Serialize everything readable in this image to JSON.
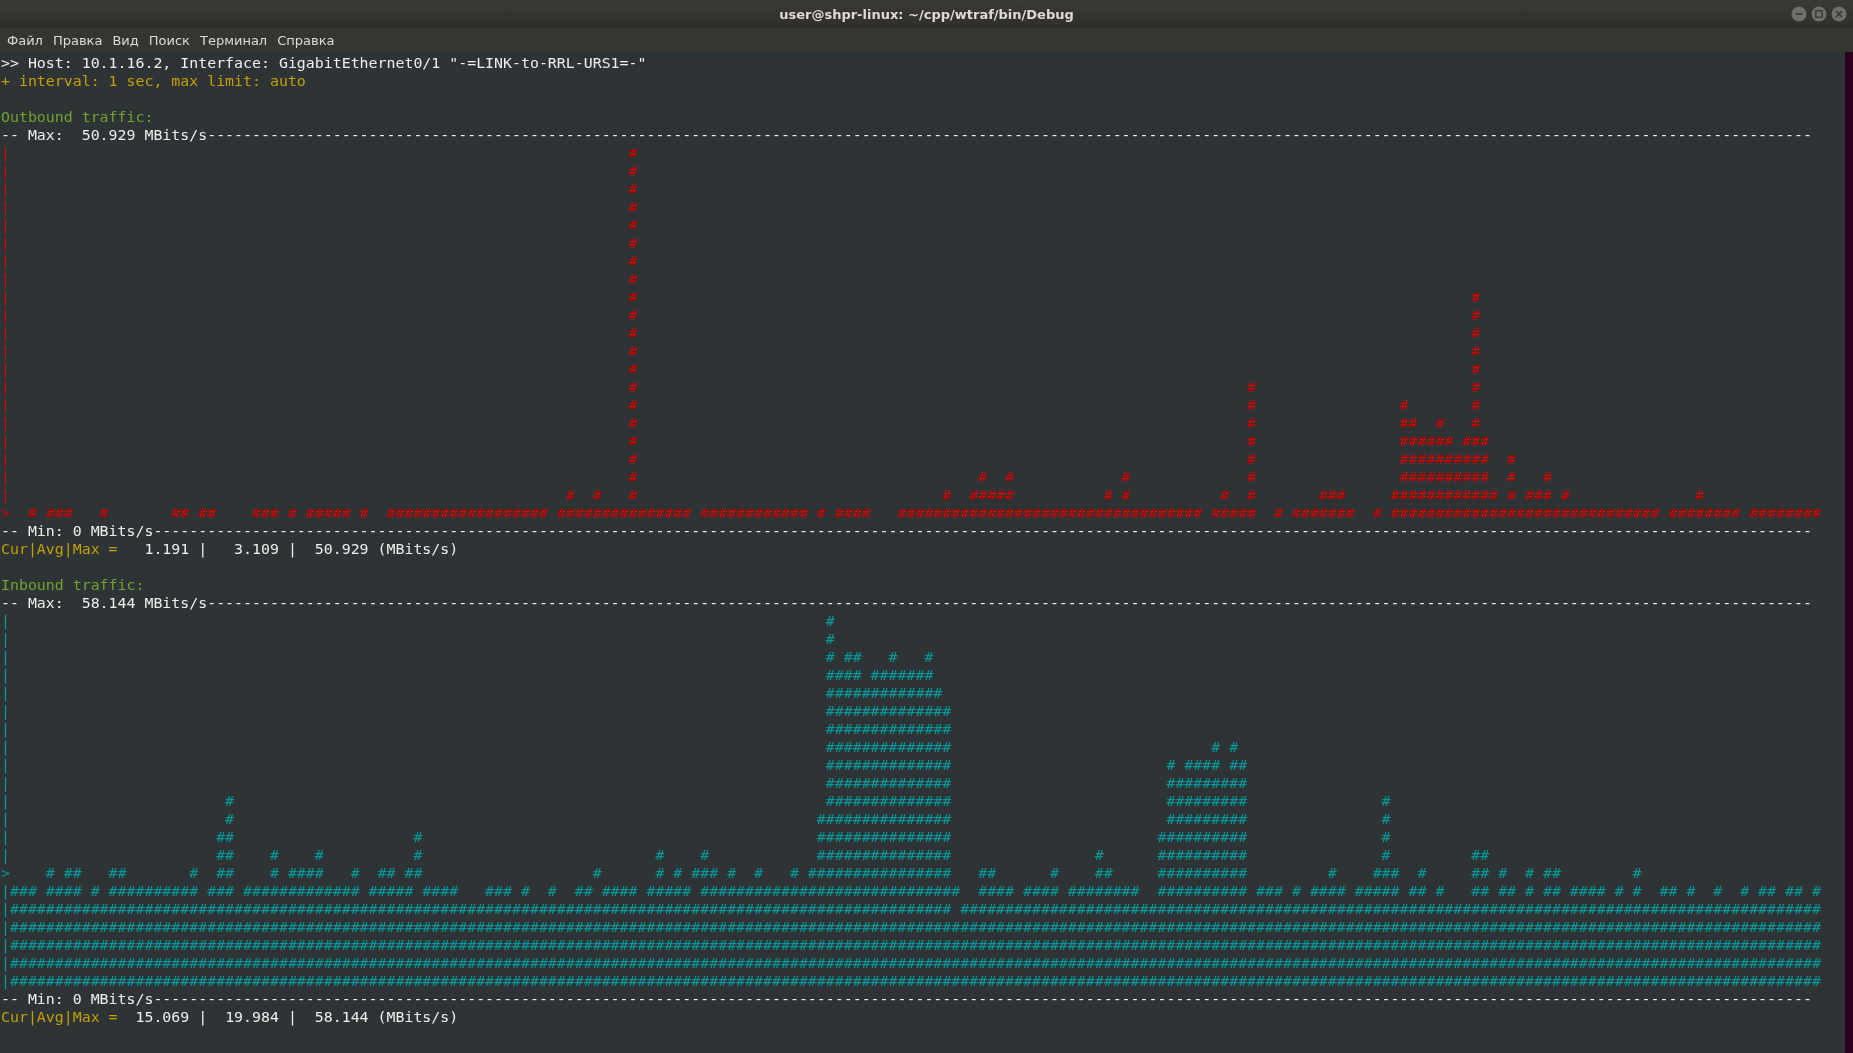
{
  "window": {
    "title": "user@shpr-linux: ~/cpp/wtraf/bin/Debug"
  },
  "menu": [
    {
      "label": "Файл"
    },
    {
      "label": "Правка"
    },
    {
      "label": "Вид"
    },
    {
      "label": "Поиск"
    },
    {
      "label": "Терминал"
    },
    {
      "label": "Справка"
    }
  ],
  "terminal": {
    "host_line": ">> Host: 10.1.16.2, Interface: GigabitEthernet0/1 \"-=LINK-to-RRL-URS1=-\"",
    "interval_line": "+ interval: 1 sec, max limit: auto",
    "sections": [
      {
        "kind": "outbound",
        "heading": "Outbound traffic:",
        "max_line": "-- Max:  50.929 MBits/s-----------------------------------------------------------------------------------------------------------------------------------------------------------------------------------",
        "rows": [
          "|                                                                     #",
          "|                                                                     #",
          "|                                                                     #",
          "|                                                                     #",
          "|                                                                     #",
          "|                                                                     #",
          "|                                                                     #",
          "|                                                                     #",
          "|                                                                     #                                                                                             #",
          "|                                                                     #                                                                                             #",
          "|                                                                     #                                                                                             #",
          "|                                                                     #                                                                                             #",
          "|                                                                     #                                                                                             #",
          "|                                                                     #                                                                    #                        #",
          "|                                                                     #                                                                    #                #       #",
          "|                                                                     #                                                                    #                ##  #   #",
          "|                                                                     #                                                                    #                ###### ###",
          "|                                                                     #                                                                    #                ##########  #",
          "|                                                                     #                                      #  #            #             #                ##########  #   #",
          "|                                                              #  #   #                                  #  #####          # #          #  #       ###     ############ # ### #              #",
          ">  # ###   #       ## ##    ### # ##### #  ################## ############### ############ # ####   ################################## #####  # #######  # ############################## ######## ########"
        ],
        "min_line": "-- Min: 0 MBits/s-----------------------------------------------------------------------------------------------------------------------------------------------------------------------------------------",
        "stats_label": "Cur|Avg|Max =",
        "stats_values": "   1.191 |   3.109 |  50.929 (MBits/s)"
      },
      {
        "kind": "inbound",
        "heading": "Inbound traffic:",
        "max_line": "-- Max:  58.144 MBits/s-----------------------------------------------------------------------------------------------------------------------------------------------------------------------------------",
        "rows": [
          "|                                                                                           #",
          "|                                                                                           #",
          "|                                                                                           # ##   #   #",
          "|                                                                                           #### #######",
          "|                                                                                           #############",
          "|                                                                                           ##############",
          "|                                                                                           ##############",
          "|                                                                                           ##############                             # #",
          "|                                                                                           ##############                        # #### ##",
          "|                                                                                           ##############                        #########",
          "|                        #                                                                  ##############                        #########               #",
          "|                        #                                                                 ###############                        #########               #",
          "|                       ##                    #                                            ###############                       ##########               #",
          "|                       ##    #    #          #                          #    #            ###############                #      ##########               #         ##",
          ">    # ##   ##       #  ##    # ####   #  ## ##                   #      # # ### #  #   # ################   ##      #    ##     ##########         #    ###  #     ## #  # ##        #",
          "|### #### # ########## ### ############# ##### ####   ### #  #  ## #### ##### #############################  #### #### ########  ########## ### # #### ##### ## #   ## ## # ## #### # #  ## #  #  # ## ## #",
          "|######################################################################################################### ################################################################################################",
          "|##########################################################################################################################################################################################################",
          "|##########################################################################################################################################################################################################",
          "|##########################################################################################################################################################################################################",
          "|##########################################################################################################################################################################################################"
        ],
        "min_line": "-- Min: 0 MBits/s-----------------------------------------------------------------------------------------------------------------------------------------------------------------------------------------",
        "stats_label": "Cur|Avg|Max =",
        "stats_values": "  15.069 |  19.984 |  58.144 (MBits/s)"
      }
    ]
  }
}
